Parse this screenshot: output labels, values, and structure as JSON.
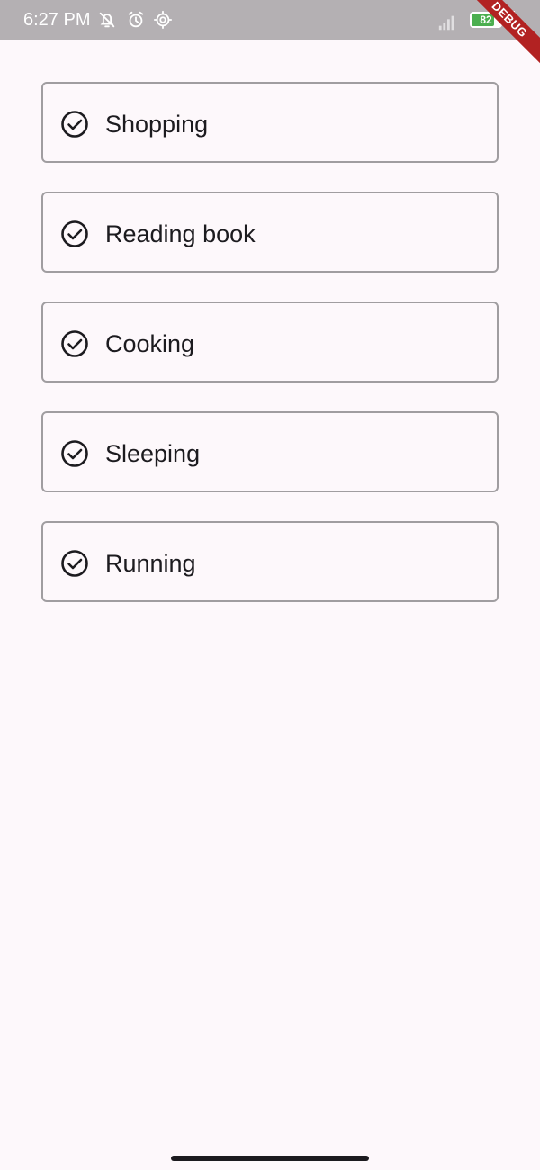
{
  "status_bar": {
    "time": "6:27 PM",
    "battery_level": "82",
    "icons": [
      "notifications-off-icon",
      "alarm-icon",
      "settings-icon",
      "signal-icon",
      "battery-icon",
      "charging-icon"
    ]
  },
  "debug_banner": "DEBUG",
  "tasks": [
    {
      "label": "Shopping",
      "icon": "check-circle-icon"
    },
    {
      "label": "Reading book",
      "icon": "check-circle-icon"
    },
    {
      "label": "Cooking",
      "icon": "check-circle-icon"
    },
    {
      "label": "Sleeping",
      "icon": "check-circle-icon"
    },
    {
      "label": "Running",
      "icon": "check-circle-icon"
    }
  ],
  "colors": {
    "background": "#fdf8fb",
    "status_bar": "#b4b0b3",
    "card_border": "#a09da0",
    "text": "#1c1b1f",
    "battery_fill": "#4caf50",
    "debug_banner": "#b22222"
  }
}
